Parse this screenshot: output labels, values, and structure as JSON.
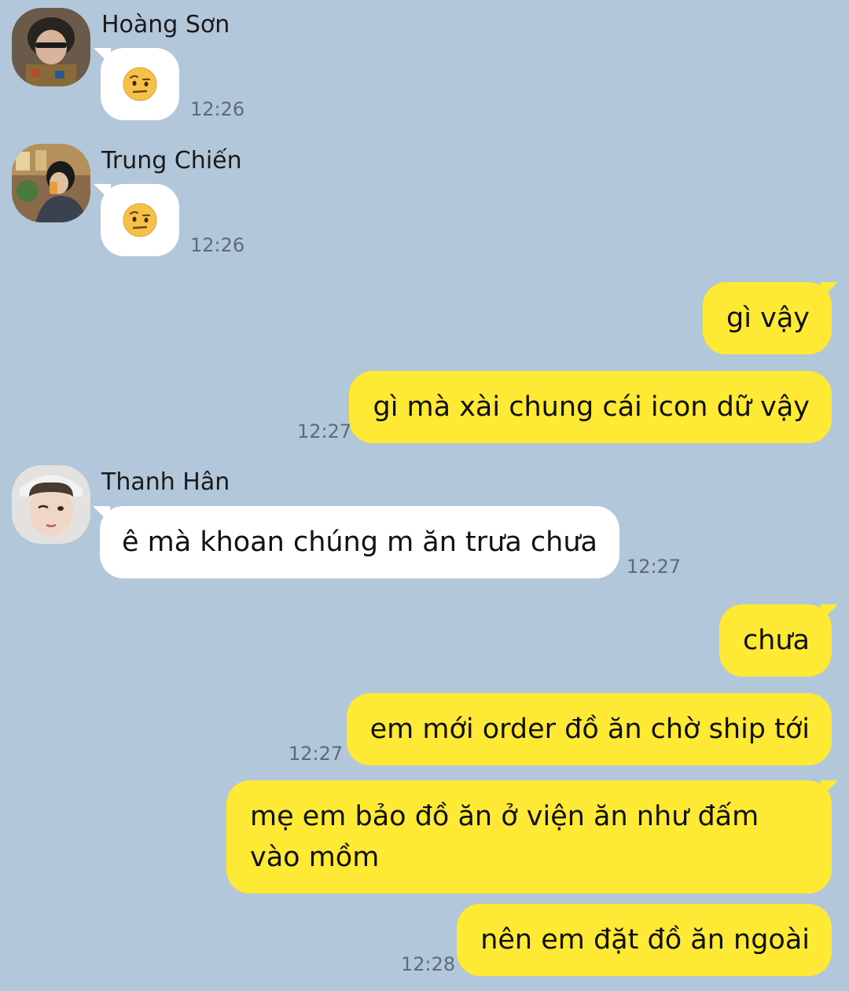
{
  "colors": {
    "background": "#b2c7da",
    "incoming_bubble": "#ffffff",
    "outgoing_bubble": "#fee934",
    "timestamp": "#5d6a77"
  },
  "messages": {
    "m1": {
      "sender": "Hoàng Sơn",
      "content": "raised-eyebrow-emoji",
      "time": "12:26"
    },
    "m2": {
      "sender": "Trung Chiến",
      "content": "raised-eyebrow-emoji",
      "time": "12:26"
    },
    "m3": {
      "text": "gì vậy"
    },
    "m4": {
      "text": "gì mà xài chung cái icon dữ vậy",
      "time": "12:27"
    },
    "m5": {
      "sender": "Thanh Hân",
      "text": "ê mà khoan chúng m ăn trưa chưa",
      "time": "12:27"
    },
    "m6": {
      "text": "chưa"
    },
    "m7": {
      "text": "em mới order đồ ăn chờ ship tới",
      "time": "12:27"
    },
    "m8": {
      "text": "mẹ em bảo đồ ăn ở viện ăn như đấm vào mồm"
    },
    "m9": {
      "text": "nên em đặt đồ ăn ngoài",
      "time": "12:28"
    }
  }
}
